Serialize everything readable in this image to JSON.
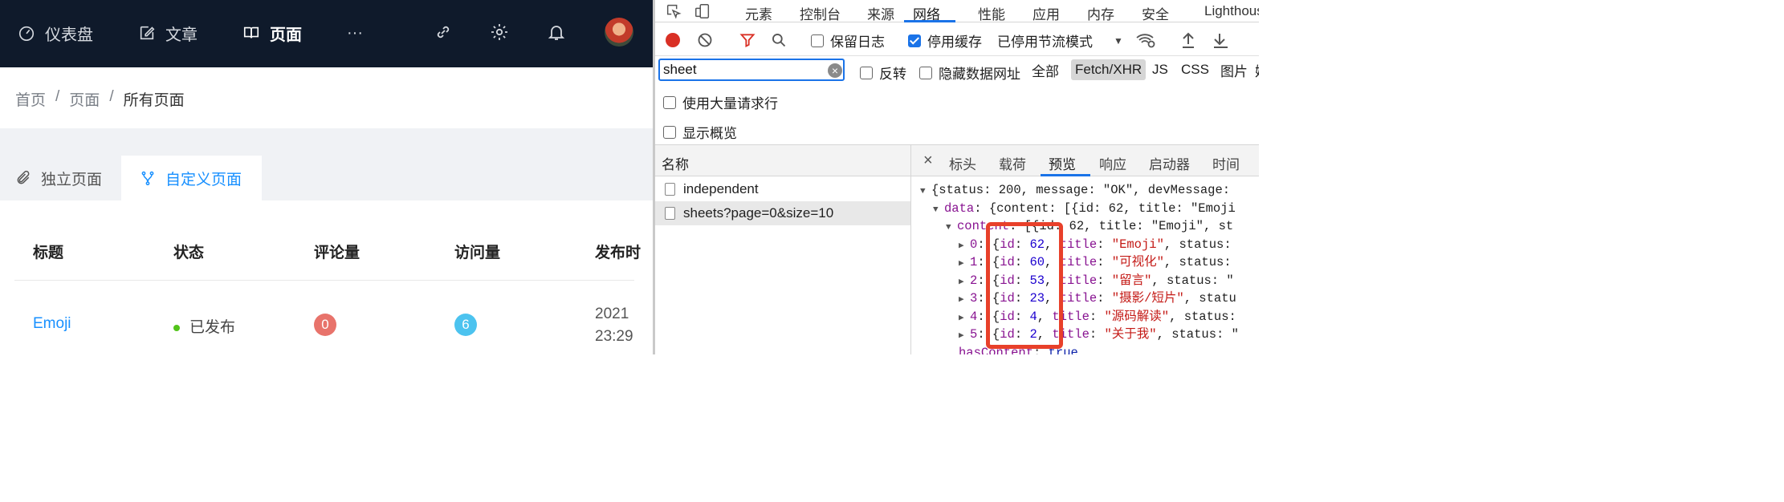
{
  "app": {
    "nav": {
      "dashboard": "仪表盘",
      "posts": "文章",
      "pages": "页面",
      "more": "···"
    },
    "breadcrumb": [
      "首页",
      "/",
      "页面",
      "/",
      "所有页面"
    ],
    "tabs": {
      "independent": "独立页面",
      "custom": "自定义页面"
    },
    "table": {
      "headers": [
        "标题",
        "状态",
        "评论量",
        "访问量",
        "发布时"
      ],
      "rows": [
        {
          "title": "Emoji",
          "status": "已发布",
          "comments": "0",
          "visits": "6",
          "date_line1": "2021",
          "date_line2": "23:29"
        }
      ]
    },
    "colors": {
      "nav_bg": "#0f1a2b",
      "accent": "#1890ff",
      "comment_badge": "#e8736b",
      "visit_badge": "#4cc3ef",
      "published_dot": "#52c41a"
    }
  },
  "devtools": {
    "tabs": [
      "元素",
      "控制台",
      "来源",
      "网络",
      "性能",
      "应用",
      "内存",
      "安全",
      "Lighthouse"
    ],
    "active_tab": "网络",
    "toolbar": {
      "preserve_log": "保留日志",
      "disable_cache": "停用缓存",
      "throttle": "已停用节流模式"
    },
    "filter": {
      "value": "sheet",
      "invert": "反转",
      "hide_data_urls": "隐藏数据网址",
      "types": [
        "全部",
        "Fetch/XHR",
        "JS",
        "CSS",
        "图片",
        "媒"
      ],
      "active_type": "Fetch/XHR"
    },
    "options": {
      "large_rows": "使用大量请求行",
      "overview": "显示概览"
    },
    "requests": {
      "column": "名称",
      "items": [
        "independent",
        "sheets?page=0&size=10"
      ]
    },
    "detail_tabs": [
      "标头",
      "载荷",
      "预览",
      "响应",
      "启动器",
      "时间"
    ],
    "active_detail_tab": "预览",
    "preview": {
      "root": "{status: 200, message: \"OK\", devMessage:",
      "data": "{content: [{id: 62, title: \"Emoji",
      "content": "[{id: 62, title: \"Emoji\", st",
      "items": [
        {
          "idx": "0",
          "id": "62",
          "title": "\"Emoji\"",
          "tail": ", status:"
        },
        {
          "idx": "1",
          "id": "60",
          "title": "\"可视化\"",
          "tail": ", status:"
        },
        {
          "idx": "2",
          "id": "53",
          "title": "\"留言\"",
          "tail": ", status: \""
        },
        {
          "idx": "3",
          "id": "23",
          "title": "\"摄影/短片\"",
          "tail": ", statu"
        },
        {
          "idx": "4",
          "id": "4",
          "title": "\"源码解读\"",
          "tail": ", status:"
        },
        {
          "idx": "5",
          "id": "2",
          "title": "\"关于我\"",
          "tail": ", status: \""
        }
      ],
      "has_content_key": "hasContent",
      "has_content_val": "true"
    }
  }
}
